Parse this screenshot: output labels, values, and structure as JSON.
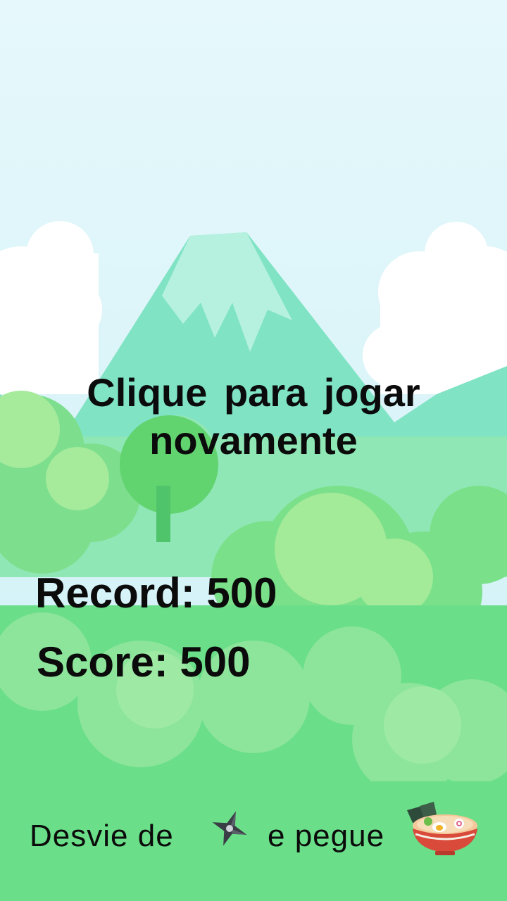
{
  "game": {
    "replay_line1": "Clique  para  jogar",
    "replay_line2": "novamente",
    "record_label": "Record: 500",
    "score_label": "Score: 500",
    "record_value": 500,
    "score_value": 500
  },
  "hint": {
    "avoid_text": "Desvie  de",
    "and_catch_text": "e  pegue",
    "obstacle_icon": "shuriken-icon",
    "collectible_icon": "ramen-bowl-icon"
  },
  "colors": {
    "sky": "#dff5fb",
    "mountain": "#7fe3c4",
    "forest_dark": "#56c97a",
    "forest_light": "#9be8a0",
    "ground": "#6ade88",
    "text": "#0b0b0b"
  }
}
